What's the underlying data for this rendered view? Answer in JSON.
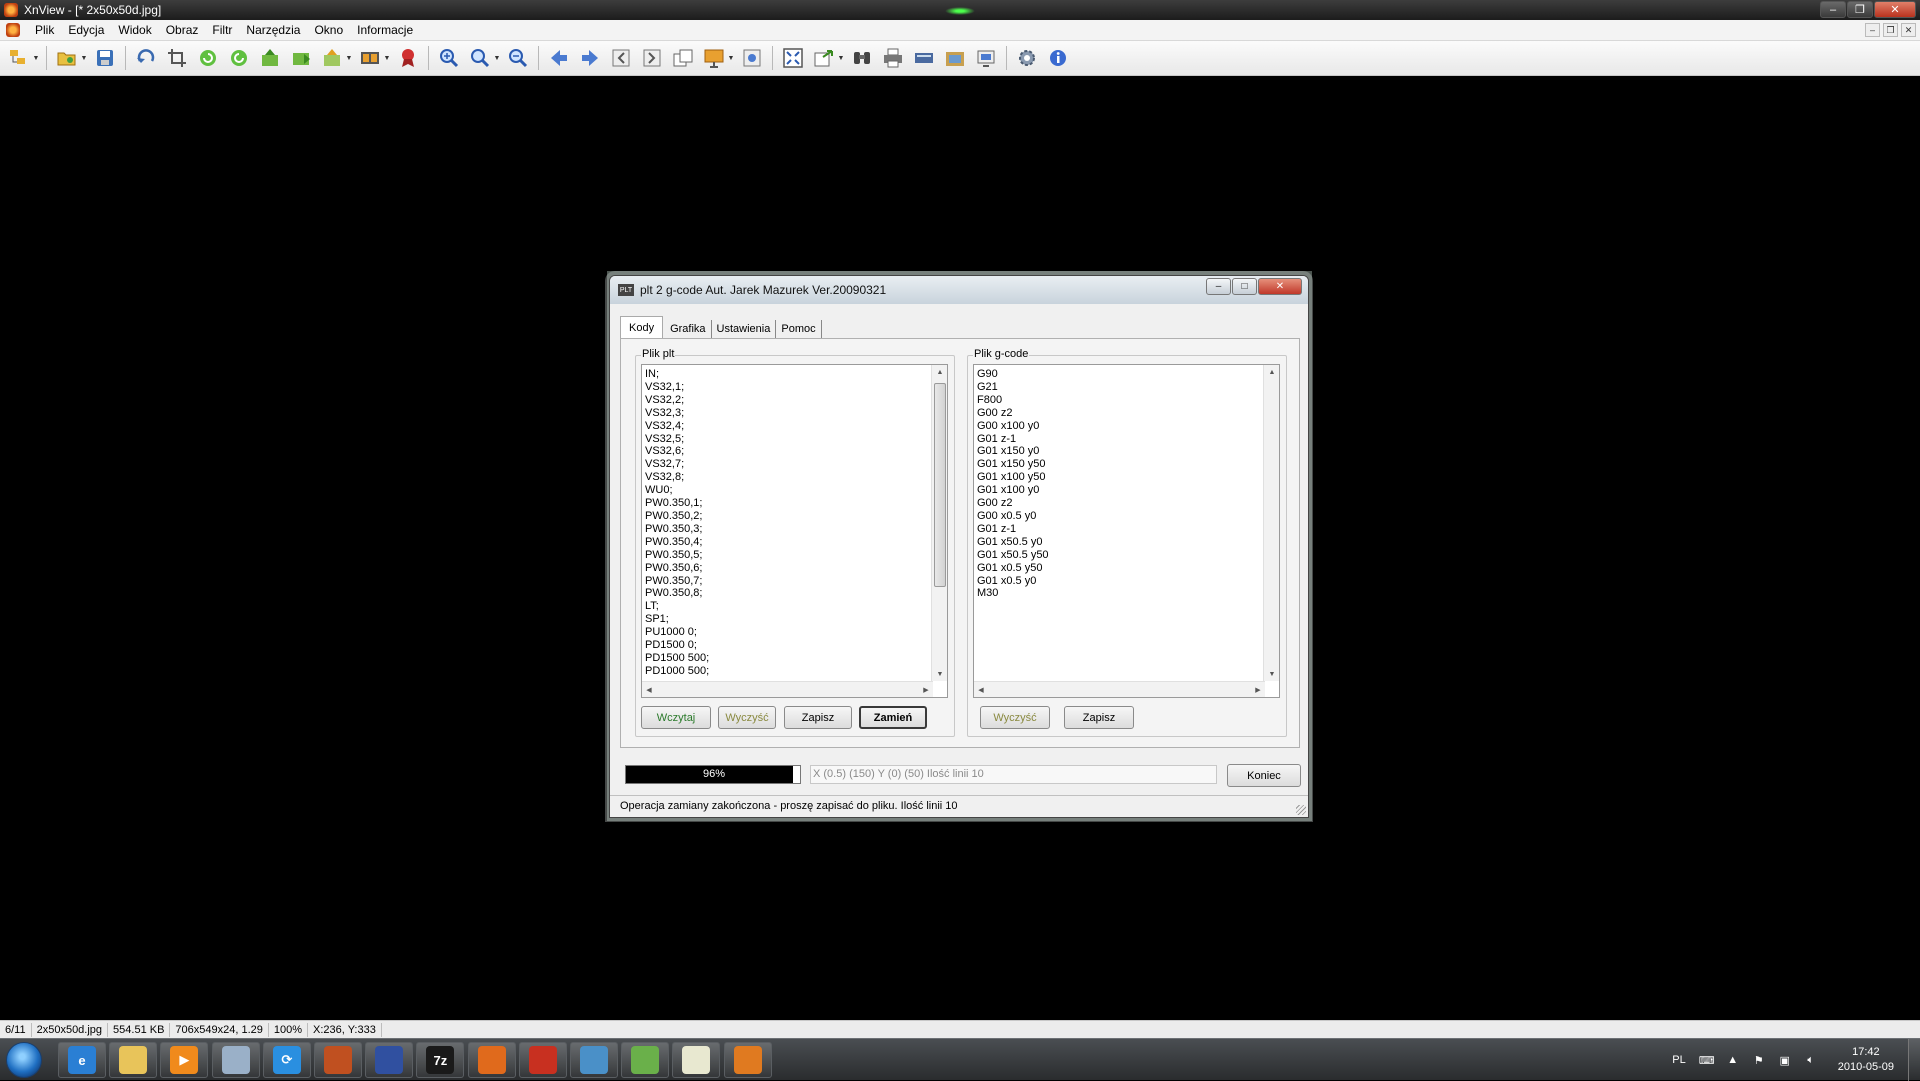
{
  "window": {
    "title": "XnView - [* 2x50x50d.jpg]"
  },
  "menubar": {
    "items": [
      "Plik",
      "Edycja",
      "Widok",
      "Obraz",
      "Filtr",
      "Narzędzia",
      "Okno",
      "Informacje"
    ]
  },
  "dialog": {
    "title": "plt 2 g-code Aut. Jarek Mazurek Ver.20090321",
    "icon_text": "PLT",
    "tabs": [
      "Kody",
      "Grafika",
      "Ustawienia",
      "Pomoc"
    ],
    "active_tab": "Kody",
    "plt_group": {
      "label": "Plik plt",
      "lines": [
        "IN;",
        "VS32,1;",
        "VS32,2;",
        "VS32,3;",
        "VS32,4;",
        "VS32,5;",
        "VS32,6;",
        "VS32,7;",
        "VS32,8;",
        "WU0;",
        "PW0.350,1;",
        "PW0.350,2;",
        "PW0.350,3;",
        "PW0.350,4;",
        "PW0.350,5;",
        "PW0.350,6;",
        "PW0.350,7;",
        "PW0.350,8;",
        "LT;",
        "SP1;",
        "PU1000 0;",
        "PD1500 0;",
        "PD1500 500;",
        "PD1000 500;"
      ],
      "buttons": {
        "load": "Wczytaj",
        "clear": "Wyczyść",
        "save": "Zapisz",
        "convert": "Zamień"
      }
    },
    "gcode_group": {
      "label": "Plik g-code",
      "lines": [
        "G90",
        "G21",
        "F800",
        "G00 z2",
        "G00 x100 y0",
        "G01 z-1",
        "G01 x150 y0",
        "G01 x150 y50",
        "G01 x100 y50",
        "G01 x100 y0",
        "G00 z2",
        "G00 x0.5 y0",
        "G01 z-1",
        "G01 x50.5 y0",
        "G01 x50.5 y50",
        "G01 x0.5 y50",
        "G01 x0.5 y0",
        "M30"
      ],
      "buttons": {
        "clear": "Wyczyść",
        "save": "Zapisz"
      }
    },
    "progress": {
      "value": 0.96,
      "label": "96%"
    },
    "coords_text": "X (0.5) (150)  Y (0) (50)  Ilość linii 10",
    "end_button": "Koniec",
    "status_text": "Operacja zamiany zakończona - proszę zapisać do pliku. Ilość linii 10"
  },
  "statusbar": {
    "items": [
      "6/11",
      "2x50x50d.jpg",
      "554.51 KB",
      "706x549x24, 1.29",
      "100%",
      "X:236, Y:333"
    ]
  },
  "taskbar": {
    "apps": [
      {
        "name": "internet-explorer",
        "label": "e",
        "color": "#2a7fd4"
      },
      {
        "name": "file-explorer",
        "label": "",
        "color": "#e8c45a"
      },
      {
        "name": "media-player",
        "label": "▶",
        "color": "#f08a1c"
      },
      {
        "name": "network-folder",
        "label": "",
        "color": "#9ab0c8"
      },
      {
        "name": "sync-app",
        "label": "⟳",
        "color": "#2a8fe0"
      },
      {
        "name": "photo-app",
        "label": "",
        "color": "#c05020"
      },
      {
        "name": "pen-tool",
        "label": "",
        "color": "#3050a0"
      },
      {
        "name": "7zip",
        "label": "7z",
        "color": "#1a1a1a"
      },
      {
        "name": "firefox",
        "label": "",
        "color": "#e06a1c"
      },
      {
        "name": "feather-app",
        "label": "",
        "color": "#c83020"
      },
      {
        "name": "messenger",
        "label": "",
        "color": "#4a90c8"
      },
      {
        "name": "green-app",
        "label": "",
        "color": "#6ab04a"
      },
      {
        "name": "notepad",
        "label": "",
        "color": "#e8e8d0"
      },
      {
        "name": "xnview",
        "label": "",
        "color": "#e07a20"
      }
    ],
    "tray": {
      "lang": "PL",
      "time": "17:42",
      "date": "2010-05-09"
    }
  }
}
